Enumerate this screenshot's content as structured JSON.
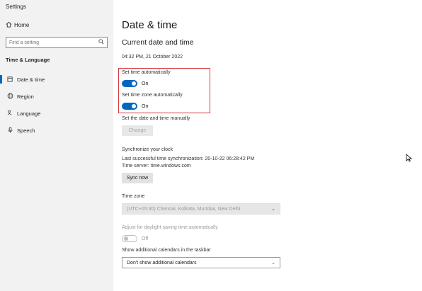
{
  "window": {
    "title": "Settings"
  },
  "sidebar": {
    "home_label": "Home",
    "search_placeholder": "Find a setting",
    "section_label": "Time & Language",
    "items": [
      {
        "label": "Date & time",
        "icon": "calendar-clock-icon",
        "selected": true
      },
      {
        "label": "Region",
        "icon": "globe-icon",
        "selected": false
      },
      {
        "label": "Language",
        "icon": "language-icon",
        "selected": false
      },
      {
        "label": "Speech",
        "icon": "microphone-icon",
        "selected": false
      }
    ]
  },
  "main": {
    "title": "Date & time",
    "current_heading": "Current date and time",
    "current_value": "04:32 PM, 21 October 2022",
    "set_time_auto": {
      "label": "Set time automatically",
      "state": "On",
      "on": true
    },
    "set_tz_auto": {
      "label": "Set time zone automatically",
      "state": "On",
      "on": true
    },
    "manual": {
      "label": "Set the date and time manually",
      "button": "Change"
    },
    "sync": {
      "heading": "Synchronize your clock",
      "last_sync": "Last successful time synchronization: 20-10-22 06:28:42 PM",
      "server": "Time server: time.windows.com",
      "button": "Sync now"
    },
    "timezone": {
      "label": "Time zone",
      "value": "(UTC+05:30) Chennai, Kolkata, Mumbai, New Delhi"
    },
    "dst": {
      "label": "Adjust for daylight saving time automatically",
      "state": "Off",
      "on": false
    },
    "calendars": {
      "label": "Show additional calendars in the taskbar",
      "value": "Don't show additional calendars"
    }
  },
  "colors": {
    "accent": "#0067c0",
    "highlight_border": "#d23a3a",
    "sidebar_bg": "#f2f2f2"
  }
}
